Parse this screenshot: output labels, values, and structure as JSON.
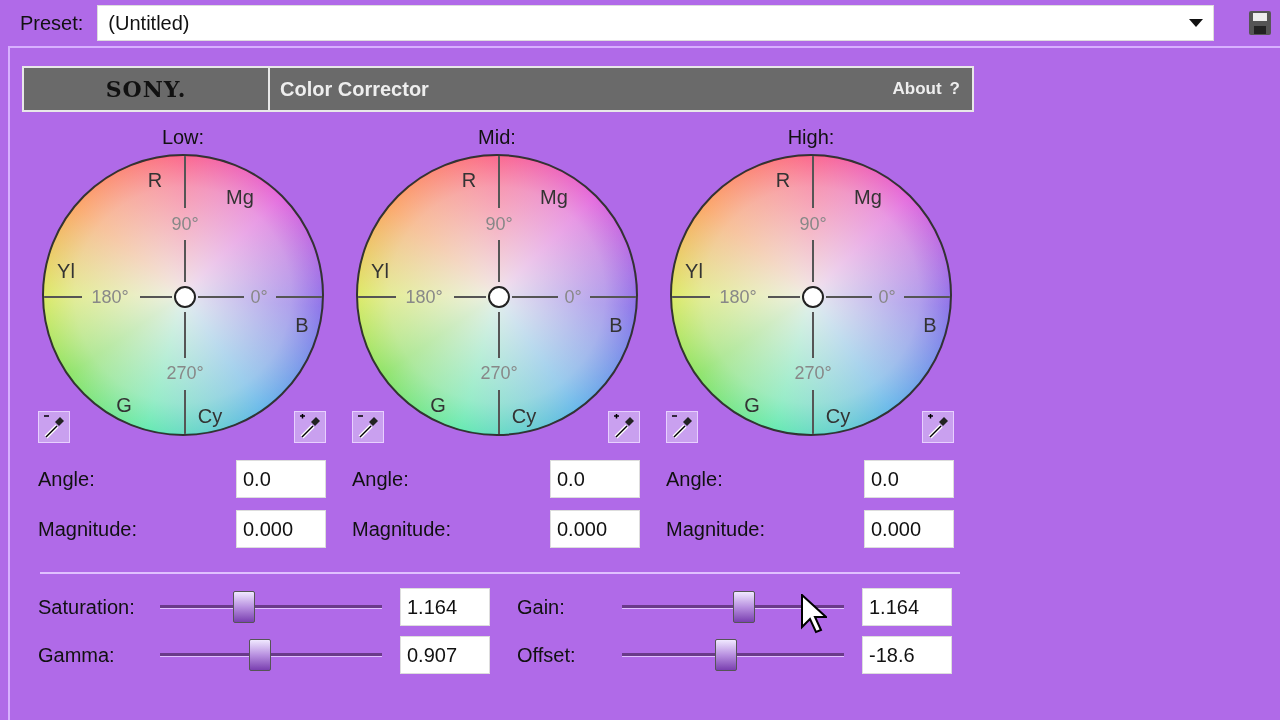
{
  "preset": {
    "label": "Preset:",
    "value": "(Untitled)"
  },
  "header": {
    "brand": "SONY.",
    "title": "Color Corrector",
    "about": "About",
    "help": "?"
  },
  "wheels": [
    {
      "label": "Low:",
      "hues": [
        "R",
        "Mg",
        "Yl",
        "B",
        "G",
        "Cy"
      ],
      "degrees": [
        "90°",
        "180°",
        "0°",
        "270°"
      ],
      "fields": [
        {
          "label": "Angle:",
          "value": "0.0"
        },
        {
          "label": "Magnitude:",
          "value": "0.000"
        }
      ]
    },
    {
      "label": "Mid:",
      "hues": [
        "R",
        "Mg",
        "Yl",
        "B",
        "G",
        "Cy"
      ],
      "degrees": [
        "90°",
        "180°",
        "0°",
        "270°"
      ],
      "fields": [
        {
          "label": "Angle:",
          "value": "0.0"
        },
        {
          "label": "Magnitude:",
          "value": "0.000"
        }
      ]
    },
    {
      "label": "High:",
      "hues": [
        "R",
        "Mg",
        "Yl",
        "B",
        "G",
        "Cy"
      ],
      "degrees": [
        "90°",
        "180°",
        "0°",
        "270°"
      ],
      "fields": [
        {
          "label": "Angle:",
          "value": "0.0"
        },
        {
          "label": "Magnitude:",
          "value": "0.000"
        }
      ]
    }
  ],
  "sliders": [
    {
      "label": "Saturation:",
      "level": 0.38,
      "value": "1.164"
    },
    {
      "label": "Gain:",
      "level": 0.55,
      "value": "1.164"
    },
    {
      "label": "Gamma:",
      "level": 0.45,
      "value": "0.907"
    },
    {
      "label": "Offset:",
      "level": 0.47,
      "value": "-18.6"
    }
  ]
}
